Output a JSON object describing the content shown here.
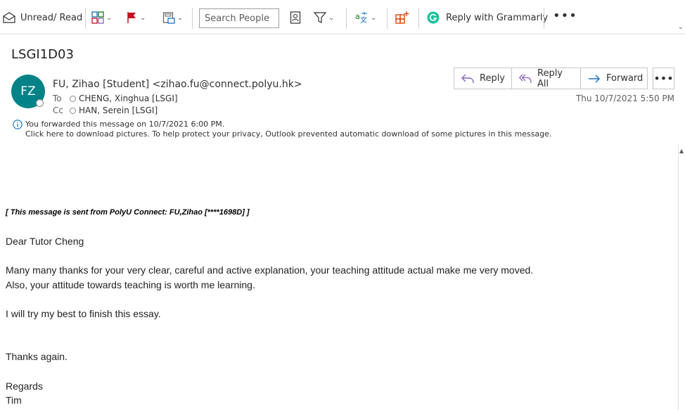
{
  "toolbar": {
    "unread_read_label": "Unread/ Read",
    "search_placeholder": "Search People",
    "grammarly_label": "Reply with Grammarly",
    "more_label": "•••"
  },
  "message": {
    "subject": "LSGI1D03",
    "avatar_initials": "FZ",
    "from": "FU, Zihao [Student] <zihao.fu@connect.polyu.hk>",
    "to_label": "To",
    "to": "CHENG, Xinghua [LSGI]",
    "cc_label": "Cc",
    "cc": "HAN, Serein [LSGI]",
    "info_line1": "You forwarded this message on 10/7/2021 6:00 PM.",
    "info_line2": "Click here to download pictures. To help protect your privacy, Outlook prevented automatic download of some pictures in this message.",
    "date": "Thu 10/7/2021 5:50 PM"
  },
  "actions": {
    "reply": "Reply",
    "reply_all": "Reply All",
    "forward": "Forward",
    "more": "•••"
  },
  "body": {
    "banner": "[ This message is sent from PolyU Connect: FU,Zihao [****1698D] ]",
    "greeting": "Dear Tutor Cheng",
    "para1_line1": "Many many thanks for your very clear, careful and active explanation, your teaching attitude actual make me very moved.",
    "para1_line2": "Also, your attitude towards teaching is worth me learning.",
    "para2": "I will try my best to finish this essay.",
    "thanks": "Thanks again.",
    "regards": "Regards",
    "signature": "Tim"
  },
  "colors": {
    "avatar": "#038387",
    "flag": "#c50f1f",
    "accent_blue": "#0f6cbd",
    "grammarly": "#15c39a",
    "translate_green": "#107c10",
    "addin_orange": "#d83b01"
  },
  "icons": [
    "envelope-icon",
    "categorize-icon",
    "flag-icon",
    "move-icon",
    "address-book-icon",
    "filter-icon",
    "translate-icon",
    "add-ins-icon",
    "grammarly-icon",
    "reply-icon",
    "reply-all-icon",
    "forward-icon",
    "info-icon"
  ]
}
